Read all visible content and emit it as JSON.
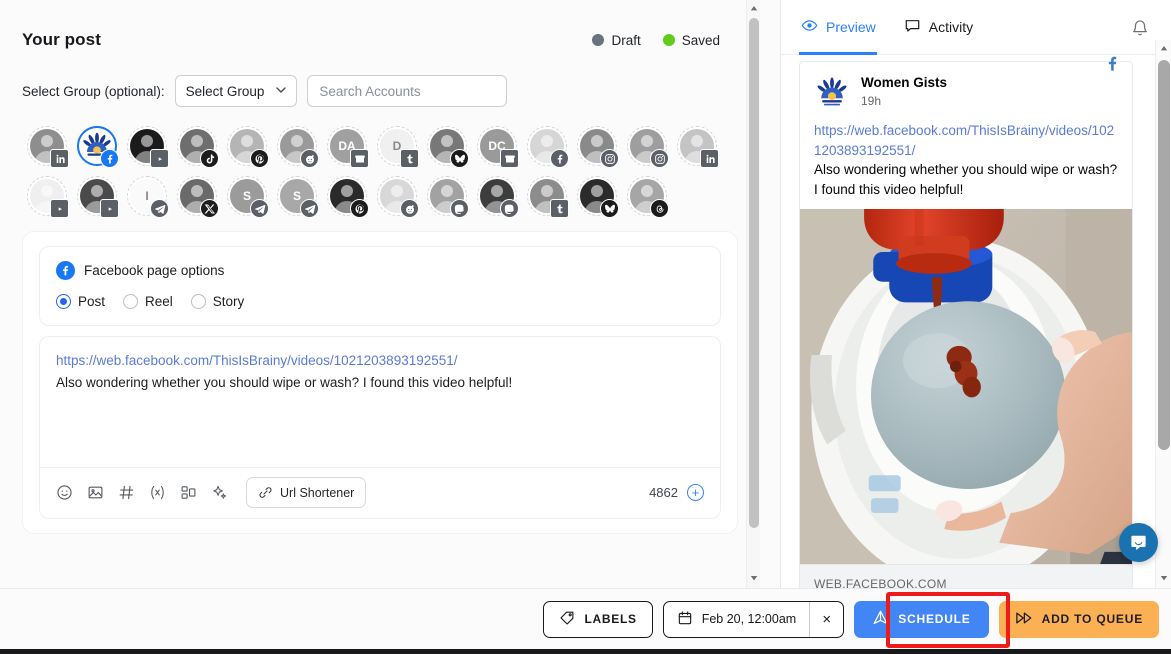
{
  "composer": {
    "title": "Your post",
    "status": [
      {
        "label": "Draft",
        "color": "#6b7280"
      },
      {
        "label": "Saved",
        "color": "#5fcc1e"
      }
    ],
    "group_label": "Select Group (optional):",
    "select_group_value": "Select Group",
    "search_placeholder": "Search Accounts",
    "accounts": [
      {
        "initial": "",
        "network": "linkedin",
        "selected": false,
        "photo": "#8e8e8e"
      },
      {
        "initial": "",
        "network": "facebook",
        "selected": true,
        "photo": "#ffffff"
      },
      {
        "initial": "",
        "network": "youtube",
        "selected": false,
        "photo": "#1b1b1b"
      },
      {
        "initial": "",
        "network": "tiktok",
        "selected": false,
        "photo": "#6e6e6e"
      },
      {
        "initial": "",
        "network": "pinterest",
        "selected": false,
        "photo": "#b5b5b5"
      },
      {
        "initial": "",
        "network": "reddit",
        "selected": false,
        "photo": "#9a9a9a"
      },
      {
        "initial": "DA",
        "network": "gbusiness",
        "selected": false,
        "photo": "#a0a0a0"
      },
      {
        "initial": "D",
        "network": "tumblr",
        "selected": false,
        "photo": "#f0f0f0"
      },
      {
        "initial": "",
        "network": "bluesky",
        "selected": false,
        "photo": "#787878"
      },
      {
        "initial": "DC",
        "network": "gbusiness",
        "selected": false,
        "photo": "#9a9a9a"
      },
      {
        "initial": "",
        "network": "facebook-grey",
        "selected": false,
        "photo": "#d6d6d6"
      },
      {
        "initial": "",
        "network": "instagram",
        "selected": false,
        "photo": "#8a8a8a"
      },
      {
        "initial": "",
        "network": "instagram",
        "selected": false,
        "photo": "#9e9e9e"
      },
      {
        "initial": "",
        "network": "linkedin",
        "selected": false,
        "photo": "#c4c4c4"
      },
      {
        "initial": "",
        "network": "youtube",
        "selected": false,
        "photo": "#efefef"
      },
      {
        "initial": "",
        "network": "youtube",
        "selected": false,
        "photo": "#4a4a4a"
      },
      {
        "initial": "I",
        "network": "telegram",
        "selected": false,
        "photo": "#fafafa"
      },
      {
        "initial": "",
        "network": "twitter-x",
        "selected": false,
        "photo": "#6a6a6a"
      },
      {
        "initial": "S",
        "network": "telegram",
        "selected": false,
        "photo": "#9b9b9b"
      },
      {
        "initial": "S",
        "network": "telegram",
        "selected": false,
        "photo": "#a8a8a8"
      },
      {
        "initial": "",
        "network": "pinterest",
        "selected": false,
        "photo": "#2a2a2a"
      },
      {
        "initial": "",
        "network": "reddit",
        "selected": false,
        "photo": "#d8d8d8"
      },
      {
        "initial": "",
        "network": "mastodon",
        "selected": false,
        "photo": "#a2a2a2"
      },
      {
        "initial": "",
        "network": "mastodon",
        "selected": false,
        "photo": "#3d3d3d"
      },
      {
        "initial": "",
        "network": "tumblr",
        "selected": false,
        "photo": "#8c8c8c"
      },
      {
        "initial": "",
        "network": "bluesky",
        "selected": false,
        "photo": "#2b2b2b"
      },
      {
        "initial": "",
        "network": "threads",
        "selected": false,
        "photo": "#a6a6a6"
      }
    ],
    "facebook_options": {
      "title": "Facebook page options",
      "modes": [
        {
          "label": "Post",
          "selected": true
        },
        {
          "label": "Reel",
          "selected": false
        },
        {
          "label": "Story",
          "selected": false
        }
      ]
    },
    "editor": {
      "link": "https://web.facebook.com/ThisIsBrainy/videos/1021203893192551/",
      "text": "Also wondering whether you should wipe or wash? I found this video helpful!",
      "tools": [
        "emoji-icon",
        "image-icon",
        "hashtag-icon",
        "variable-icon",
        "template-icon",
        "ai-sparkle-icon"
      ],
      "url_shortener_label": "Url Shortener",
      "char_count": "4862",
      "add_label": "+"
    }
  },
  "preview": {
    "tabs": [
      {
        "label": "Preview",
        "icon": "eye-icon",
        "active": true
      },
      {
        "label": "Activity",
        "icon": "comment-icon",
        "active": false
      }
    ],
    "post": {
      "account_name": "Women Gists",
      "time": "19h",
      "link": "https://web.facebook.com/ThisIsBrainy/videos/1021203893192551/",
      "body": "Also wondering whether you should wipe or wash? I found this video helpful!",
      "meta_domain": "WEB.FACEBOOK.COM"
    }
  },
  "bottom_bar": {
    "labels_button": "LABELS",
    "date_value": "Feb 20, 12:00am",
    "clear_date": "×",
    "schedule_button": "SCHEDULE",
    "queue_button": "ADD TO QUEUE",
    "highlight_color": "#ef1b1b",
    "schedule_color": "#4285f4",
    "queue_color": "#fcb054"
  }
}
